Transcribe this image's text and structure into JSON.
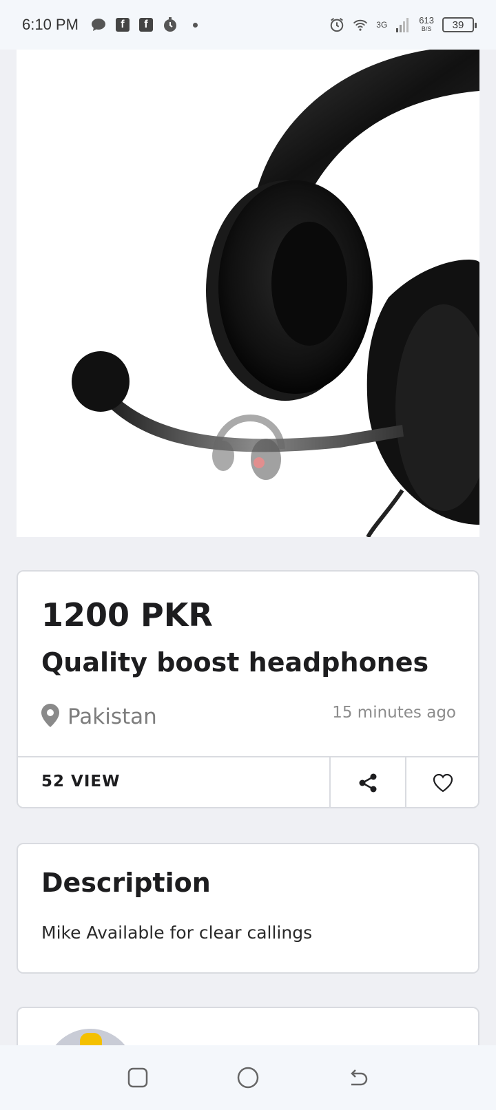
{
  "status_bar": {
    "time": "6:10 PM",
    "network": "3G",
    "speed_value": "613",
    "speed_unit": "B/S",
    "battery": "39"
  },
  "product": {
    "image_icon": "headphones-image",
    "price": "1200 PKR",
    "title": "Quality boost headphones",
    "location": "Pakistan",
    "posted": "15 minutes ago",
    "views": "52 VIEW"
  },
  "description": {
    "heading": "Description",
    "text": "Mike Available for clear callings"
  },
  "nav": {
    "recents_icon": "square-icon",
    "home_icon": "circle-icon",
    "back_icon": "back-icon"
  },
  "colors": {
    "background": "#eff0f4",
    "card": "#ffffff",
    "border": "#d9dbe0",
    "muted_text": "#7d7d7d"
  }
}
